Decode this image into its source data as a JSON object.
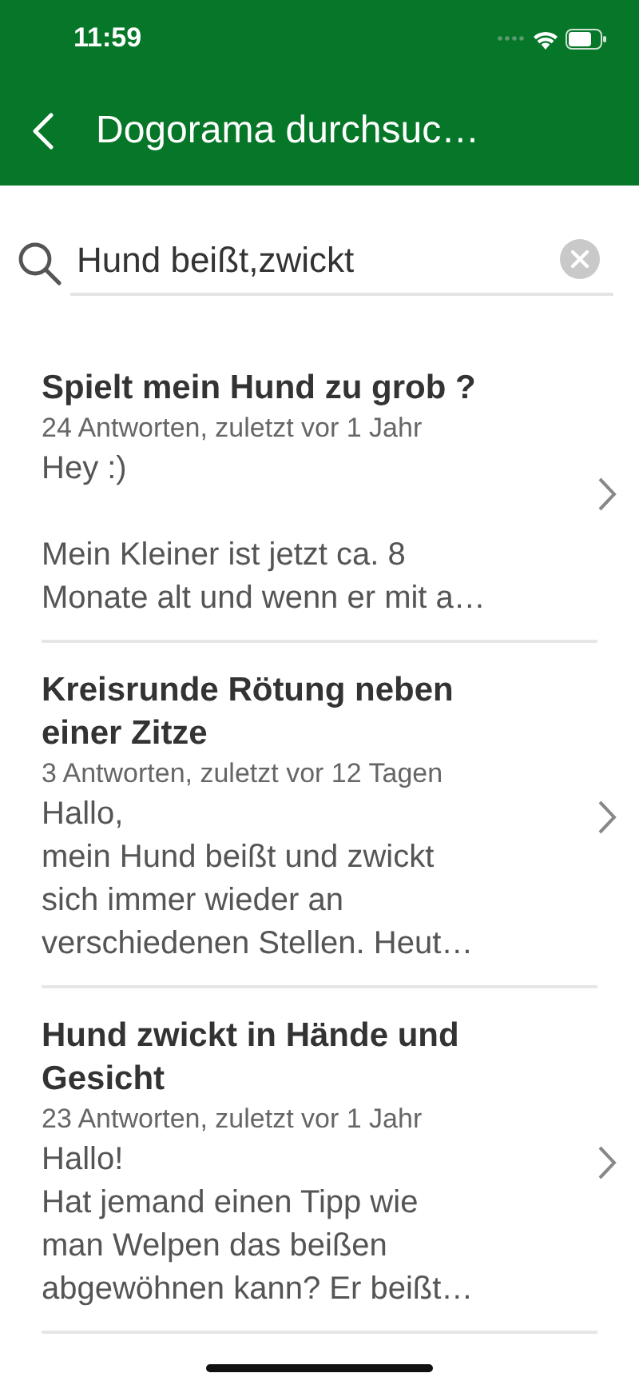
{
  "status_bar": {
    "time": "11:59"
  },
  "nav_bar": {
    "title": "Dogorama durchsuc…"
  },
  "search": {
    "value": "Hund beißt,zwickt"
  },
  "results": [
    {
      "title_lines": [
        "Spielt mein Hund zu grob ?"
      ],
      "meta": "24 Antworten, zuletzt vor 1 Jahr",
      "excerpt": [
        [
          "Hey :)"
        ],
        [
          "Mein Kleiner ist jetzt ca. 8",
          "Monate alt und wenn er mit a…"
        ]
      ]
    },
    {
      "title_lines": [
        "Kreisrunde Rötung neben",
        "einer Zitze"
      ],
      "meta": "3 Antworten, zuletzt vor 12 Tagen",
      "excerpt": [
        [
          "Hallo,",
          "mein Hund beißt und zwickt",
          "sich immer wieder an",
          "verschiedenen Stellen. Heut…"
        ]
      ]
    },
    {
      "title_lines": [
        "Hund zwickt in Hände und",
        "Gesicht"
      ],
      "meta": "23 Antworten, zuletzt vor 1 Jahr",
      "excerpt": [
        [
          "Hallo!",
          "Hat jemand einen Tipp wie",
          "man Welpen das beißen",
          "abgewöhnen kann? Er beißt…"
        ]
      ]
    }
  ]
}
